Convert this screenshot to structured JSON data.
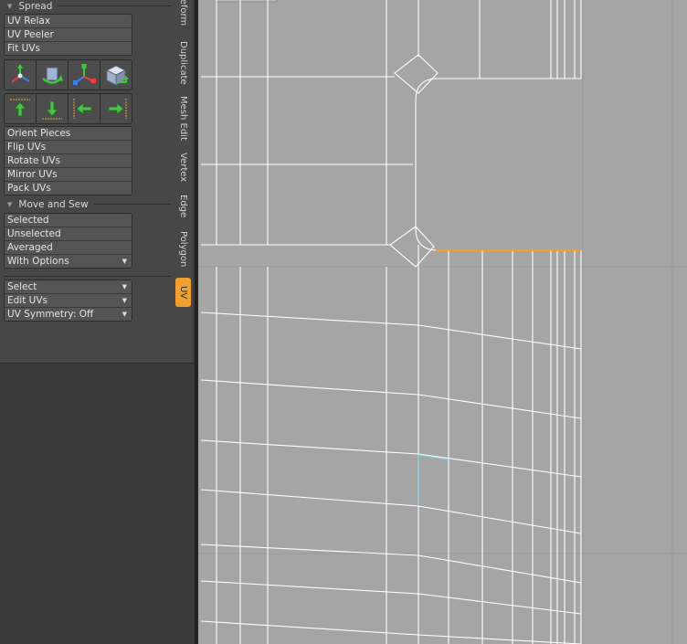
{
  "panel": {
    "spread_header": "Spread",
    "spread_buttons": [
      "UV Relax",
      "UV Peeler",
      "Fit UVs"
    ],
    "transform_icons": [
      "uv-move-gizmo-icon",
      "uv-rotate-gizmo-icon",
      "uv-scale-gizmo-icon",
      "uv-transform-cube-icon"
    ],
    "align_icons": [
      "align-top-arrow-icon",
      "align-bottom-arrow-icon",
      "align-left-arrow-icon",
      "align-right-arrow-icon"
    ],
    "orient_buttons": [
      "Orient Pieces",
      "Flip UVs",
      "Rotate UVs",
      "Mirror UVs",
      "Pack UVs"
    ],
    "move_sew_header": "Move and Sew",
    "move_sew_buttons": [
      "Selected",
      "Unselected",
      "Averaged",
      "With Options"
    ],
    "dropdowns": [
      "Select",
      "Edit UVs",
      "UV Symmetry: Off"
    ]
  },
  "tabs": [
    "Deform",
    "Duplicate",
    "Mesh Edit",
    "Vertex",
    "Edge",
    "Polygon",
    "UV"
  ],
  "active_tab": "UV",
  "colors": {
    "accent": "#f0a030",
    "panel_bg": "#474747",
    "button_bg": "#545454",
    "viewport_bg": "#a5a5a5",
    "mesh_edge": "#ffffff",
    "selected_edge": "#f0a030",
    "hover_edge": "#8fd0e8"
  }
}
